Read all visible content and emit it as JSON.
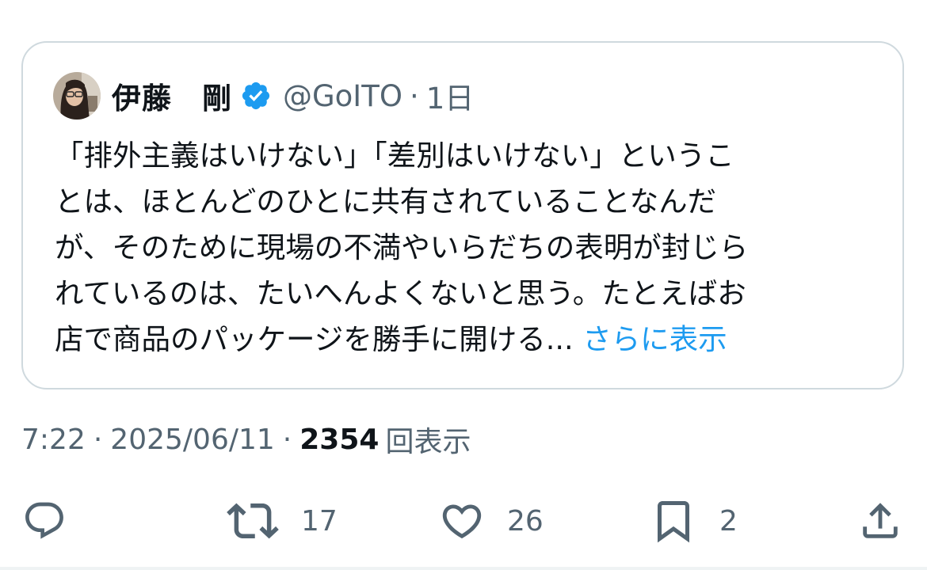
{
  "quoted_post": {
    "display_name": "伊藤　剛",
    "handle": "@GoITO",
    "separator": "·",
    "age": "1日",
    "text_lines": [
      "「排外主義はいけない」「差別はいけない」というこ",
      "とは、ほとんどのひとに共有されていることなんだ",
      "が、そのために現場の不満やいらだちの表明が封じら",
      "れているのは、たいへんよくないと思う。たとえばお",
      "店で商品のパッケージを勝手に開ける..."
    ],
    "show_more": "さらに表示"
  },
  "meta": {
    "time": "7:22",
    "sep1": "·",
    "date": "2025/06/11",
    "sep2": "·",
    "views_count": "2354",
    "views_label": "回表示"
  },
  "actions": {
    "reply_icon": "reply-icon",
    "retweet_icon": "retweet-icon",
    "retweet_count": "17",
    "like_icon": "heart-icon",
    "like_count": "26",
    "bookmark_icon": "bookmark-icon",
    "bookmark_count": "2",
    "share_icon": "share-icon"
  },
  "colors": {
    "primary_text": "#0f1419",
    "secondary_text": "#536471",
    "verified": "#1d9bf0",
    "link": "#1d9bf0",
    "border": "#cfd9de"
  }
}
